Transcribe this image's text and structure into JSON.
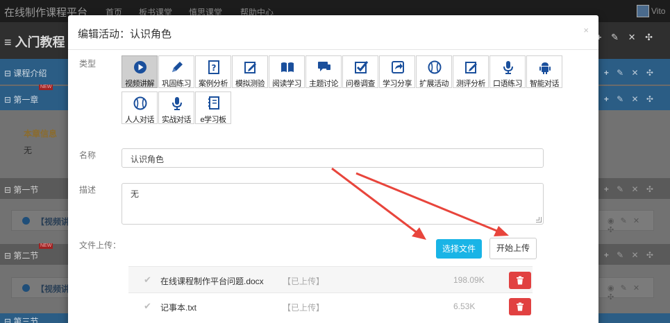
{
  "topnav": {
    "brand": "在线制作课程平台",
    "links": [
      "首页",
      "板书课堂",
      "慎思课堂",
      "帮助中心"
    ],
    "user_name": "Vito"
  },
  "course": {
    "title": "≡ 入门教程",
    "tools": "+ ✎ ✕ ✣"
  },
  "outline": {
    "intro": "⊟ 课程介绍",
    "chapter1": "⊟ 第一章",
    "chapter_info_label": "本章信息",
    "chapter_info_value": "无",
    "section1": "⊟ 第一节",
    "video1": "【视频讲",
    "section2": "⊟ 第二节",
    "video2": "【视频讲",
    "section3": "⊟ 第三节",
    "new_badge": "NEW",
    "row_tools": "+ ✎ ✕ ✣",
    "item_tools": "◉ ✎ ✕ ✣"
  },
  "modal": {
    "title": "编辑活动：认识角色",
    "close": "×",
    "type_label": "类型",
    "name_label": "名称",
    "name_value": "认识角色",
    "desc_label": "描述",
    "desc_value": "无",
    "upload_label": "文件上传：",
    "choose_button": "选择文件",
    "upload_button": "开始上传",
    "types": [
      {
        "label": "视频讲解",
        "icon": "play-circle-icon",
        "selected": true
      },
      {
        "label": "巩固练习",
        "icon": "pencil-icon"
      },
      {
        "label": "案例分析",
        "icon": "question-file-icon"
      },
      {
        "label": "模拟测验",
        "icon": "edit-doc-icon"
      },
      {
        "label": "阅读学习",
        "icon": "book-icon"
      },
      {
        "label": "主题讨论",
        "icon": "chat-bubble-icon"
      },
      {
        "label": "问卷调查",
        "icon": "checkbox-icon"
      },
      {
        "label": "学习分享",
        "icon": "share-icon"
      },
      {
        "label": "扩展活动",
        "icon": "baseball-icon"
      },
      {
        "label": "测评分析",
        "icon": "edit-doc-icon"
      },
      {
        "label": "口语练习",
        "icon": "microphone-icon"
      },
      {
        "label": "智能对话",
        "icon": "android-robot-icon"
      },
      {
        "label": "人人对话",
        "icon": "baseball-icon"
      },
      {
        "label": "实战对话",
        "icon": "microphone-icon"
      },
      {
        "label": "e学习板",
        "icon": "notebook-icon"
      }
    ],
    "files": [
      {
        "name": "在线课程制作平台问题.docx",
        "status": "【已上传】",
        "size": "198.09K"
      },
      {
        "name": "记事本.txt",
        "status": "【已上传】",
        "size": "6.53K"
      }
    ]
  },
  "colors": {
    "accent": "#19b4e6",
    "danger": "#e14141",
    "annotation_arrow": "#e8453c"
  }
}
